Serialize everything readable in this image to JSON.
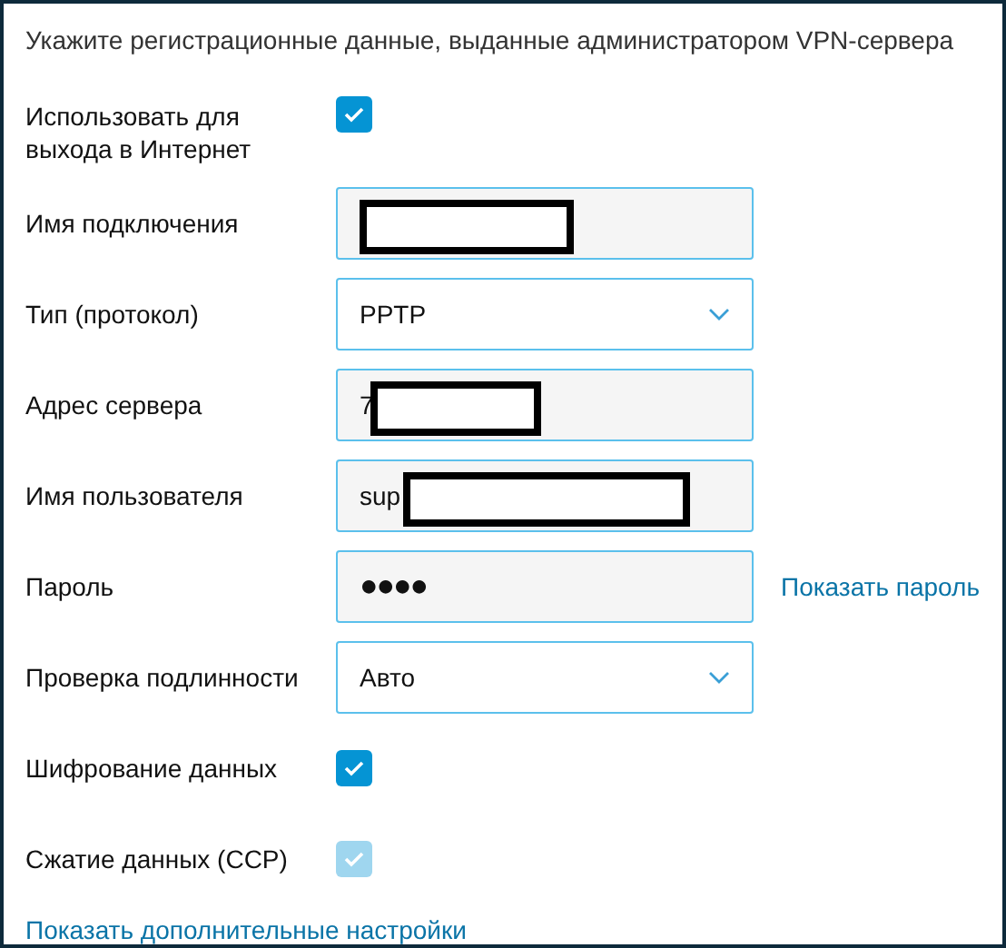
{
  "heading": "Укажите регистрационные данные, выданные администратором VPN-сервера",
  "rows": [
    {
      "kind": "checkbox",
      "label": "Использовать для выхода в Интернет",
      "checked": true,
      "disabled": false
    },
    {
      "kind": "text",
      "label": "Имя подключения",
      "redacted": true
    },
    {
      "kind": "select",
      "label": "Тип (протокол)",
      "value": "PPTP"
    },
    {
      "kind": "text",
      "label": "Адрес сервера",
      "value": "7",
      "redacted": true
    },
    {
      "kind": "text",
      "label": "Имя пользователя",
      "value": "sup",
      "redacted": true
    },
    {
      "kind": "password",
      "label": "Пароль",
      "value": "●●●●",
      "action": "Показать пароль"
    },
    {
      "kind": "select",
      "label": "Проверка подлинности",
      "value": "Авто"
    },
    {
      "kind": "checkbox",
      "label": "Шифрование данных",
      "checked": true,
      "disabled": false
    },
    {
      "kind": "checkbox",
      "label": "Сжатие данных (CCP)",
      "checked": true,
      "disabled": true
    }
  ],
  "more_link": "Показать дополнительные настройки"
}
